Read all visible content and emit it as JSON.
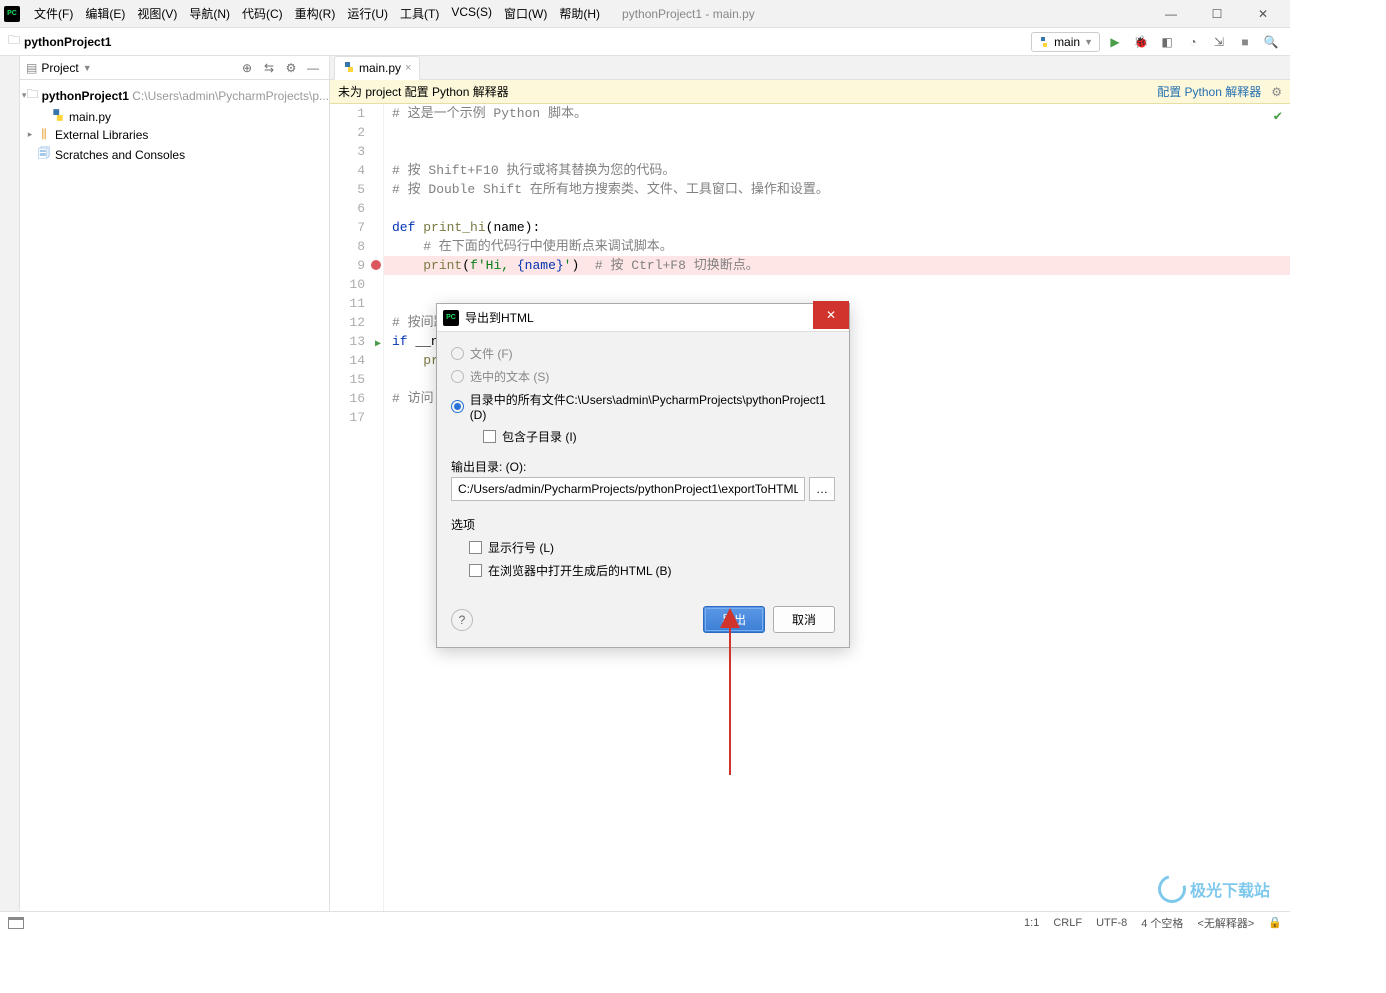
{
  "menu": [
    "文件(F)",
    "编辑(E)",
    "视图(V)",
    "导航(N)",
    "代码(C)",
    "重构(R)",
    "运行(U)",
    "工具(T)",
    "VCS(S)",
    "窗口(W)",
    "帮助(H)"
  ],
  "window_title": "pythonProject1 - main.py",
  "breadcrumb_project": "pythonProject1",
  "run_config": {
    "name": "main"
  },
  "project_panel": {
    "title": "Project",
    "root": {
      "name": "pythonProject1",
      "path": "C:\\Users\\admin\\PycharmProjects\\p..."
    },
    "file": "main.py",
    "external": "External Libraries",
    "scratches": "Scratches and Consoles"
  },
  "tab": {
    "name": "main.py"
  },
  "banner": {
    "text": "未为 project 配置 Python 解释器",
    "link": "配置 Python 解释器"
  },
  "code": {
    "l1": "# 这是一个示例 Python 脚本。",
    "l4a": "# 按 Shift+F10 执行或将其替换为您的代码。",
    "l5a": "# 按 Double Shift 在所有地方搜索类、文件、工具窗口、操作和设置。",
    "l7_def": "def",
    "l7_fn": "print_hi",
    "l7_par": "(name):",
    "l8": "    # 在下面的代码行中使用断点来调试脚本。",
    "l9_print": "print",
    "l9_op": "(",
    "l9_f": "f'Hi, ",
    "l9_tpl": "{name}",
    "l9_end": "'",
    "l9_cp": ")",
    "l9_cm": "  # 按 Ctrl+F8 切换断点。",
    "l12": "# 按间距",
    "l13_if": "if",
    "l13_rest": " __na",
    "l14": "    pri",
    "l16": "# 访问 h"
  },
  "line_numbers": [
    "1",
    "2",
    "3",
    "4",
    "5",
    "6",
    "7",
    "8",
    "9",
    "10",
    "11",
    "12",
    "13",
    "14",
    "15",
    "16",
    "17"
  ],
  "dialog": {
    "title": "导出到HTML",
    "radio_file": "文件 (F)",
    "radio_selected": "选中的文本 (S)",
    "radio_dir": "目录中的所有文件C:\\Users\\admin\\PycharmProjects\\pythonProject1 (D)",
    "chk_subdirs": "包含子目录 (I)",
    "output_label": "输出目录: (O):",
    "output_path": "C:/Users/admin/PycharmProjects/pythonProject1\\exportToHTML",
    "options_label": "选项",
    "chk_linenum": "显示行号 (L)",
    "chk_openbrowser": "在浏览器中打开生成后的HTML (B)",
    "btn_export": "导出",
    "btn_cancel": "取消"
  },
  "status": {
    "pos": "1:1",
    "eol": "CRLF",
    "enc": "UTF-8",
    "indent": "4 个空格",
    "interp": "<无解释器>"
  },
  "watermark": "极光下载站"
}
